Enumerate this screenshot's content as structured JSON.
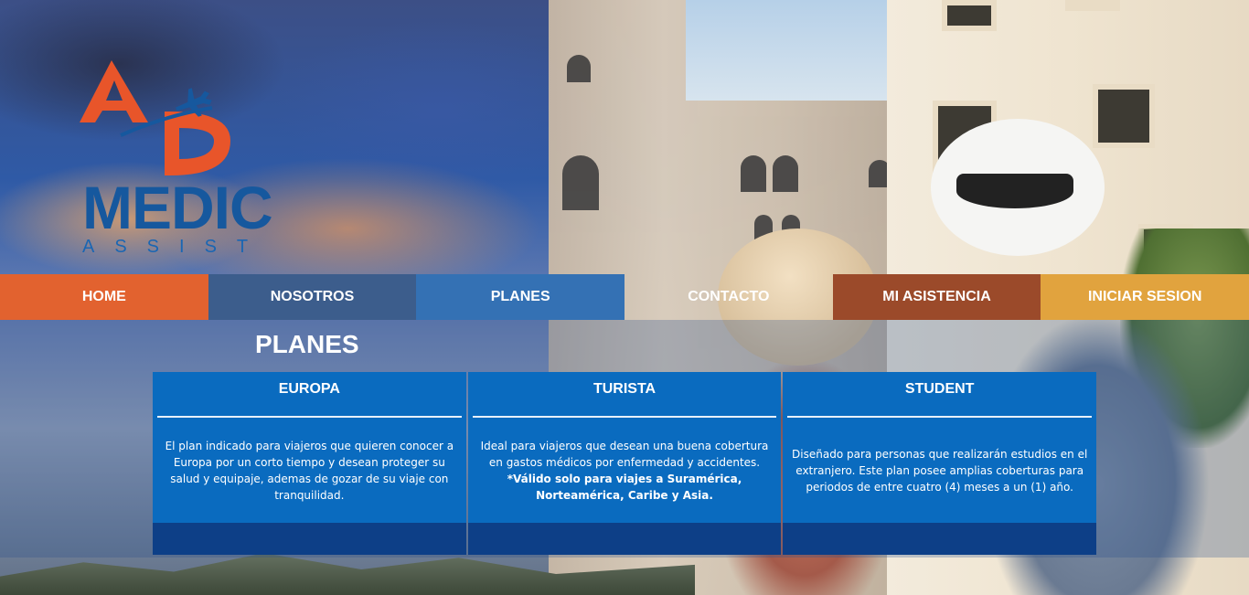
{
  "logo": {
    "line1": "MEDIC",
    "line2": "ASSIST",
    "icon": "plane-icon",
    "colors": {
      "orange": "#e8552a",
      "blue": "#16589e"
    }
  },
  "nav": {
    "items": [
      {
        "label": "HOME",
        "color": "#e2622f"
      },
      {
        "label": "NOSOTROS",
        "color": "#3c5d8c"
      },
      {
        "label": "PLANES",
        "color": "#3471b4"
      },
      {
        "label": "CONTACTO",
        "color": "transparent"
      },
      {
        "label": "MI ASISTENCIA",
        "color": "#9b4a2a"
      },
      {
        "label": "INICIAR SESION",
        "color": "#e1a33e"
      }
    ]
  },
  "section": {
    "title": "PLANES"
  },
  "plans": [
    {
      "name": "EUROPA",
      "description": "El plan indicado para viajeros que quieren conocer a Europa por un corto tiempo y desean proteger su salud y equipaje, ademas de gozar de su viaje con tranquilidad.",
      "note": ""
    },
    {
      "name": "TURISTA",
      "description": "Ideal para viajeros que desean una buena cobertura en gastos médicos por enfermedad y accidentes.",
      "note": "*Válido solo para viajes a Suramérica, Norteamérica, Caribe y Asia."
    },
    {
      "name": "STUDENT",
      "description": "Diseñado para personas que realizarán estudios en el extranjero. Este plan posee amplias coberturas para periodos de entre cuatro (4) meses a un (1) año.",
      "note": ""
    }
  ],
  "colors": {
    "card": "#0a6bbf",
    "card_footer": "#0d3f87"
  }
}
